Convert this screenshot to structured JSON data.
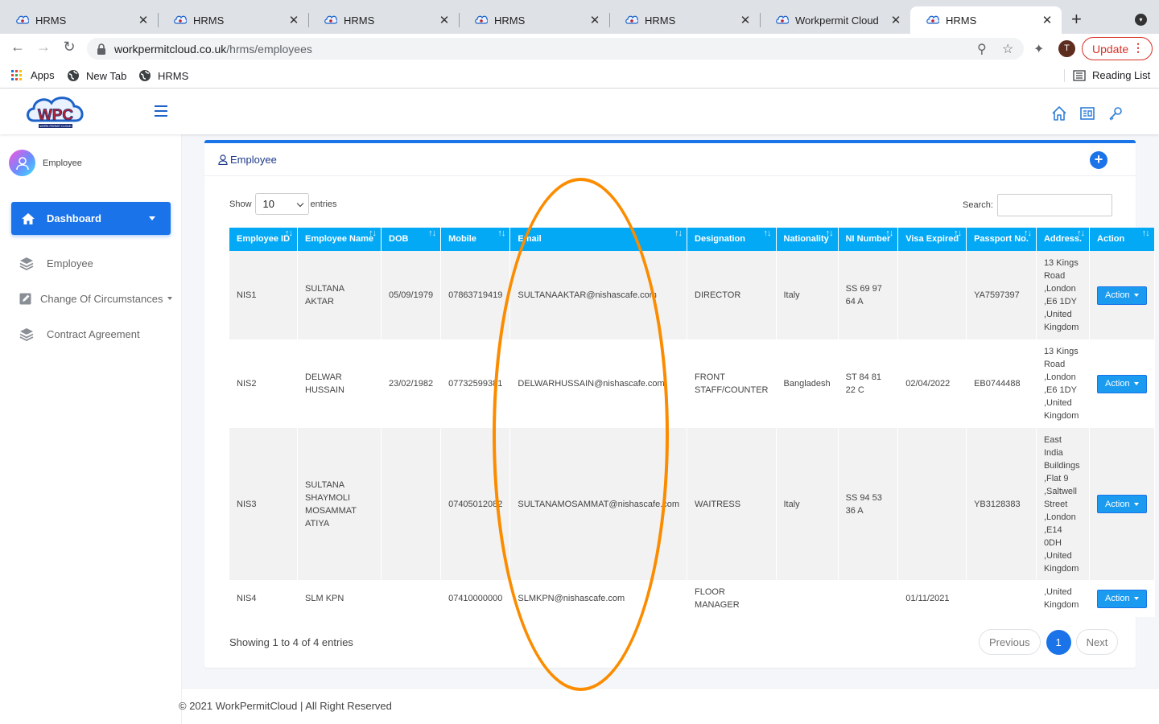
{
  "browser": {
    "tabs": [
      {
        "title": "HRMS"
      },
      {
        "title": "HRMS"
      },
      {
        "title": "HRMS"
      },
      {
        "title": "HRMS"
      },
      {
        "title": "HRMS"
      },
      {
        "title": "Workpermit Cloud"
      },
      {
        "title": "HRMS"
      }
    ],
    "active_tab": 6,
    "url_host": "workpermitcloud.co.uk",
    "url_path": "/hrms/employees",
    "profile_initial": "T",
    "update_label": "Update",
    "bookmarks": [
      {
        "label": "Apps"
      },
      {
        "label": "New Tab"
      },
      {
        "label": "HRMS"
      }
    ],
    "reading_list": "Reading List"
  },
  "header": {
    "logo_text": "WPC",
    "logo_tagline": "WORK PERMIT CLOUD",
    "icons": [
      "home-icon",
      "document-icon",
      "key-icon"
    ]
  },
  "sidebar": {
    "user_label": "Employee",
    "dashboard_label": "Dashboard",
    "items": [
      {
        "label": "Employee",
        "icon": "layers-icon"
      },
      {
        "label": "Change Of Circumstances",
        "icon": "edit-icon"
      },
      {
        "label": "Contract Agreement",
        "icon": "layers-icon"
      }
    ]
  },
  "card": {
    "title": "Employee",
    "show_label": "Show",
    "entries_value": "10",
    "entries_label": "entries",
    "search_label": "Search:",
    "search_value": ""
  },
  "table": {
    "columns": [
      "Employee ID",
      "Employee Name",
      "DOB",
      "Mobile",
      "Email",
      "Designation",
      "Nationality",
      "NI Number",
      "Visa Expired",
      "Passport No.",
      "Address.",
      "Action"
    ],
    "rows": [
      {
        "id": "NIS1",
        "name": [
          "SULTANA",
          "AKTAR"
        ],
        "dob": "05/09/1979",
        "mobile": "07863719419",
        "email": "SULTANAAKTAR@nishascafe.com",
        "designation": [
          "DIRECTOR"
        ],
        "nationality": "Italy",
        "ni": [
          "SS 69 97",
          "64 A"
        ],
        "visa": "",
        "passport": "YA7597397",
        "address": [
          "13 Kings",
          "Road",
          ",London",
          ",E6 1DY",
          ",United",
          "Kingdom"
        ],
        "action": "Action"
      },
      {
        "id": "NIS2",
        "name": [
          "DELWAR",
          "HUSSAIN"
        ],
        "dob": "23/02/1982",
        "mobile": "07732599381",
        "email": "DELWARHUSSAIN@nishascafe.com",
        "designation": [
          "FRONT",
          "STAFF/COUNTER"
        ],
        "nationality": "Bangladesh",
        "ni": [
          "ST 84 81",
          "22 C"
        ],
        "visa": "02/04/2022",
        "passport": "EB0744488",
        "address": [
          "13 Kings",
          "Road",
          ",London",
          ",E6 1DY",
          ",United",
          "Kingdom"
        ],
        "action": "Action"
      },
      {
        "id": "NIS3",
        "name": [
          "SULTANA",
          "SHAYMOLI",
          "MOSAMMAT",
          "ATIYA"
        ],
        "dob": "",
        "mobile": "07405012082",
        "email": "SULTANAMOSAMMAT@nishascafe.com",
        "designation": [
          "WAITRESS"
        ],
        "nationality": "Italy",
        "ni": [
          "SS 94 53",
          "36 A"
        ],
        "visa": "",
        "passport": "YB3128383",
        "address": [
          "East",
          "India",
          "Buildings",
          ",Flat 9",
          ",Saltwell",
          "Street",
          ",London",
          ",E14",
          "0DH",
          ",United",
          "Kingdom"
        ],
        "action": "Action"
      },
      {
        "id": "NIS4",
        "name": [
          "SLM KPN"
        ],
        "dob": "",
        "mobile": "07410000000",
        "email": "SLMKPN@nishascafe.com",
        "designation": [
          "FLOOR",
          "MANAGER"
        ],
        "nationality": "",
        "ni": [
          ""
        ],
        "visa": "01/11/2021",
        "passport": "",
        "address": [
          ",United",
          "Kingdom"
        ],
        "action": "Action"
      }
    ]
  },
  "footer_info": {
    "showing": "Showing 1 to 4 of 4 entries",
    "previous": "Previous",
    "page": "1",
    "next": "Next"
  },
  "footer": {
    "copyright": "© 2021 WorkPermitCloud | All Right Reserved"
  },
  "colors": {
    "primary": "#1a73e8",
    "table_header": "#03a9f4",
    "annotation": "#fb8c00",
    "update_red": "#d93025"
  }
}
